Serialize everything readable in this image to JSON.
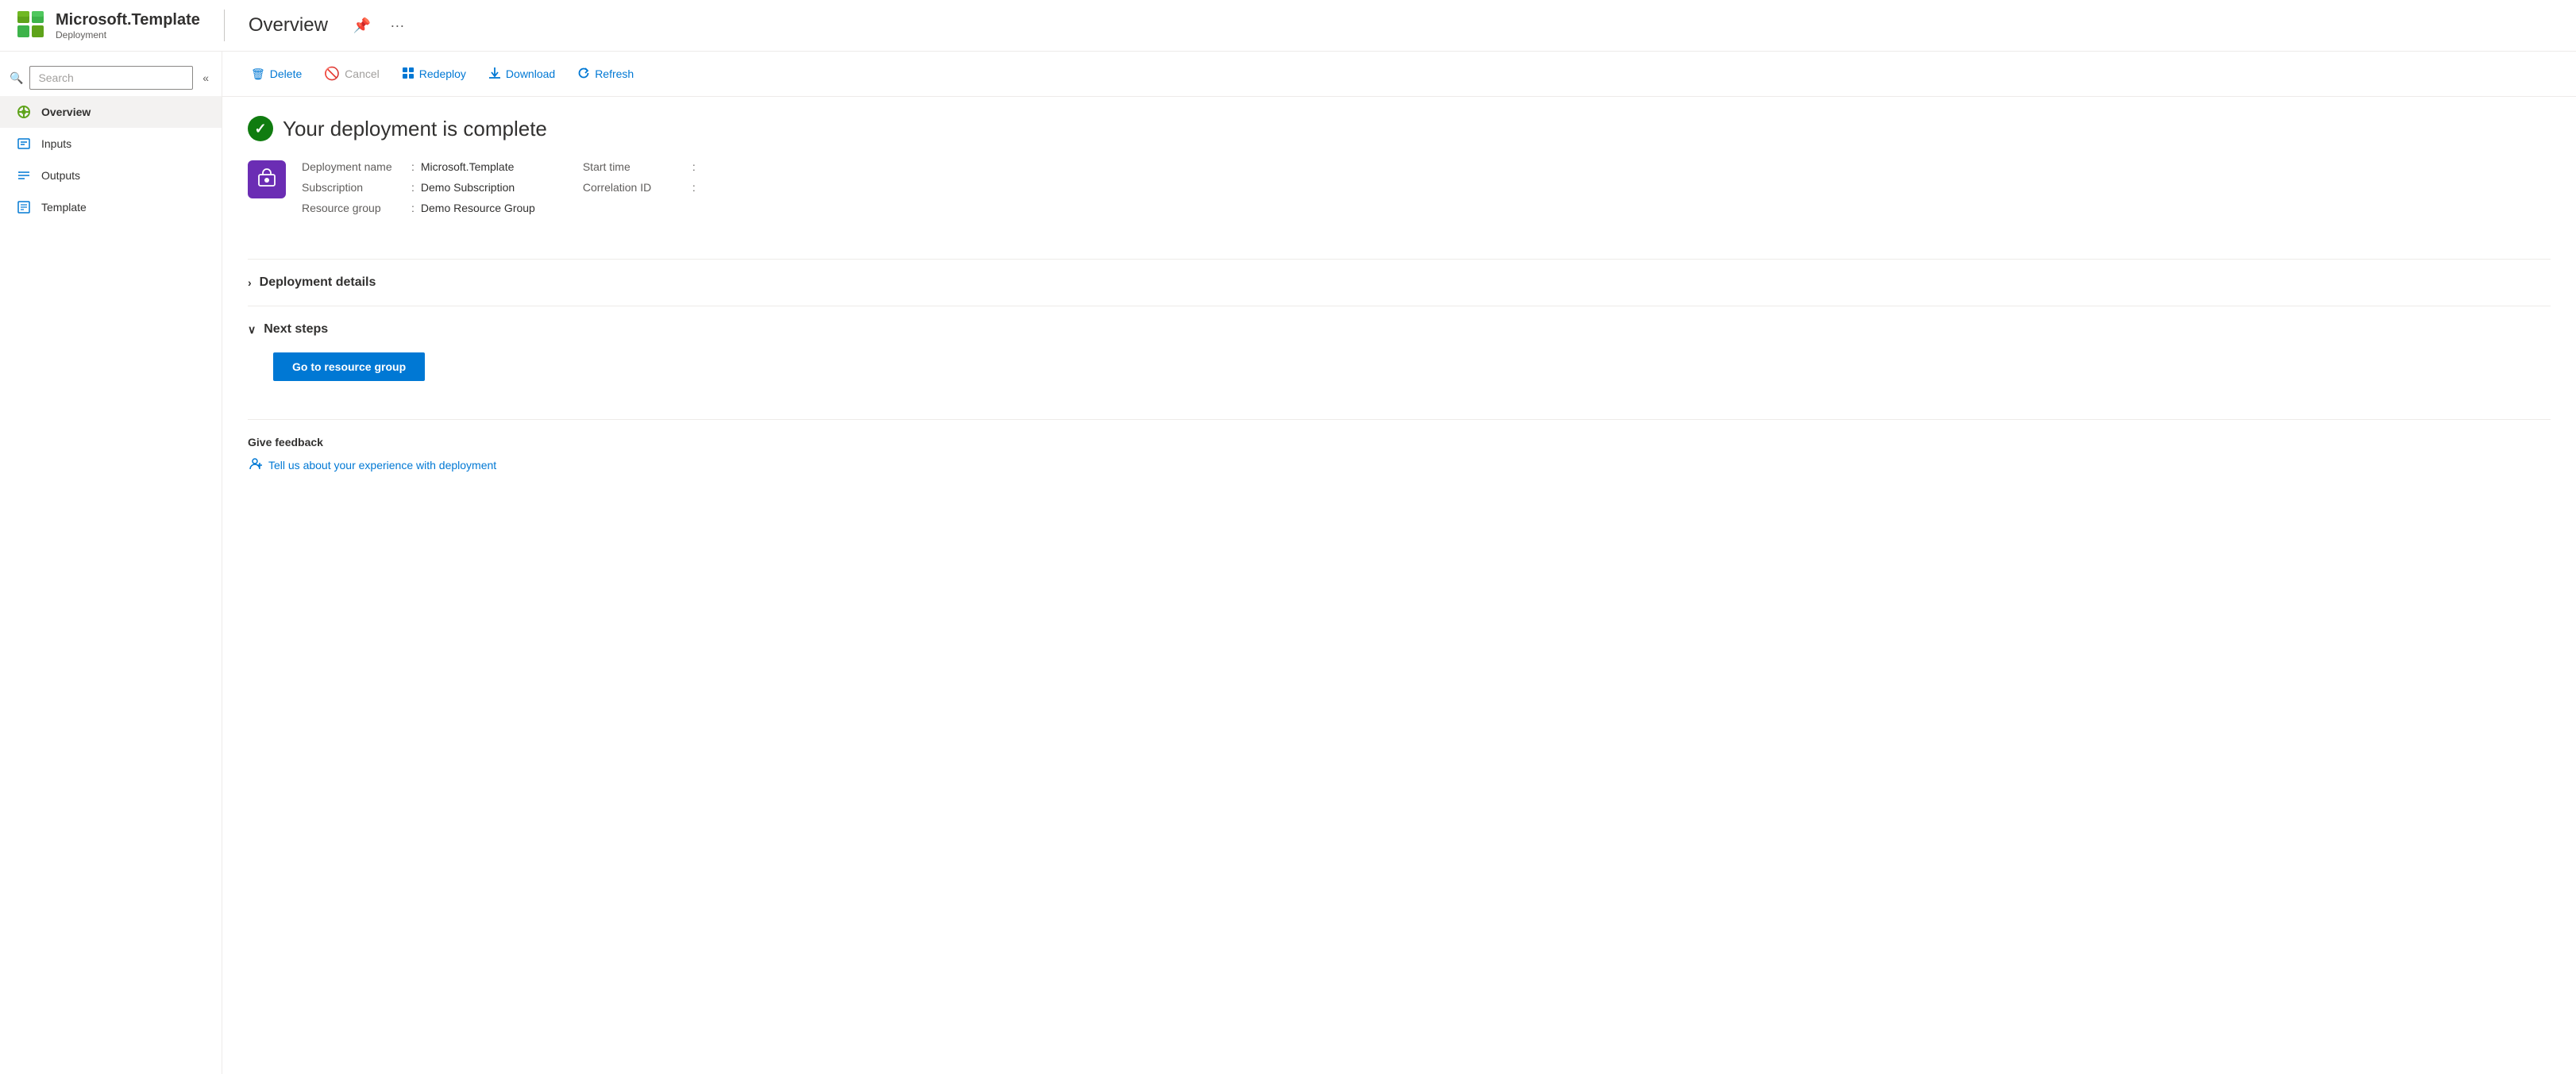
{
  "header": {
    "app_name": "Microsoft.Template",
    "app_subtitle": "Deployment",
    "divider": true,
    "page_title": "Overview",
    "pin_icon": "📌",
    "more_icon": "···"
  },
  "sidebar": {
    "search_placeholder": "Search",
    "collapse_icon": "«",
    "nav_items": [
      {
        "id": "overview",
        "label": "Overview",
        "active": true
      },
      {
        "id": "inputs",
        "label": "Inputs",
        "active": false
      },
      {
        "id": "outputs",
        "label": "Outputs",
        "active": false
      },
      {
        "id": "template",
        "label": "Template",
        "active": false
      }
    ]
  },
  "toolbar": {
    "delete_label": "Delete",
    "cancel_label": "Cancel",
    "redeploy_label": "Redeploy",
    "download_label": "Download",
    "refresh_label": "Refresh"
  },
  "content": {
    "status_message": "Your deployment is complete",
    "deployment_name_label": "Deployment name",
    "deployment_name_value": "Microsoft.Template",
    "subscription_label": "Subscription",
    "subscription_value": "Demo Subscription",
    "resource_group_label": "Resource group",
    "resource_group_value": "Demo Resource Group",
    "start_time_label": "Start time",
    "start_time_value": "",
    "correlation_id_label": "Correlation ID",
    "correlation_id_value": "",
    "deployment_details_label": "Deployment details",
    "next_steps_label": "Next steps",
    "goto_resource_group_label": "Go to resource group",
    "feedback_title": "Give feedback",
    "feedback_link": "Tell us about your experience with deployment"
  }
}
